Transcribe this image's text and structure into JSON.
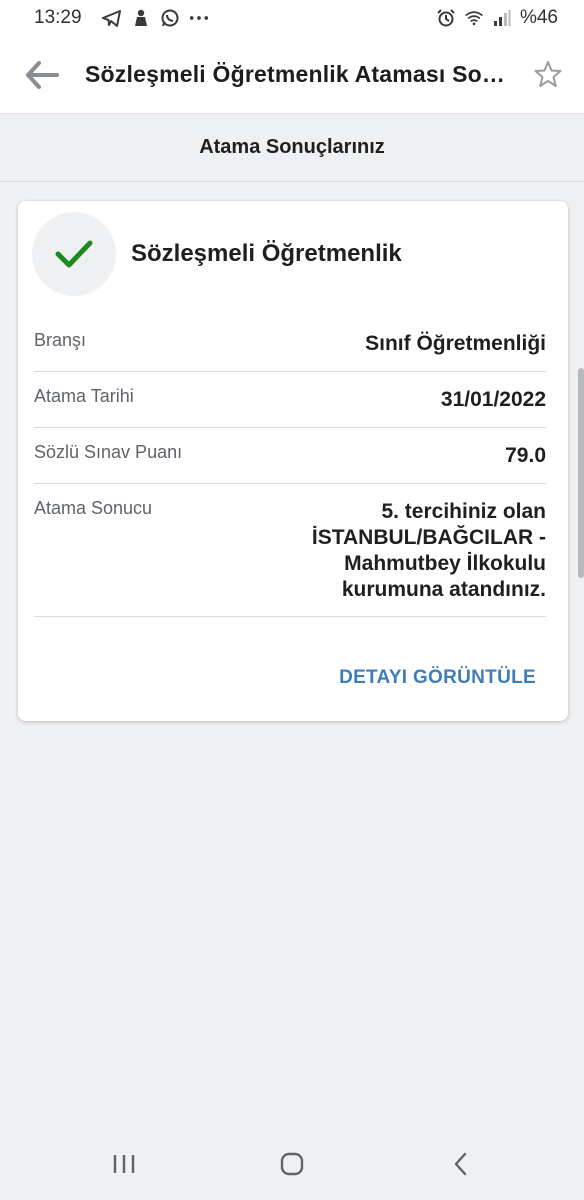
{
  "status_bar": {
    "time": "13:29",
    "battery": "%46",
    "icons": [
      "telegram-icon",
      "notification-icon",
      "whatsapp-icon",
      "more-dots-icon",
      "alarm-icon",
      "wifi-icon",
      "signal-icon"
    ]
  },
  "app_bar": {
    "title": "Sözleşmeli Öğretmenlik Ataması Sonuçları",
    "back_icon": "back-arrow-icon",
    "favorite_icon": "star-outline-icon"
  },
  "section": {
    "title": "Atama Sonuçlarınız"
  },
  "card": {
    "title": "Sözleşmeli Öğretmenlik",
    "status_icon": "checkmark-icon",
    "status_color": "#1e8a1e",
    "rows": [
      {
        "label": "Branşı",
        "value": "Sınıf Öğretmenliği"
      },
      {
        "label": "Atama Tarihi",
        "value": "31/01/2022"
      },
      {
        "label": "Sözlü Sınav Puanı",
        "value": "79.0"
      },
      {
        "label": "Atama Sonucu",
        "value": "5. tercihiniz olan\nİSTANBUL/BAĞCILAR -\nMahmutbey İlkokulu\nkurumuna atandınız."
      }
    ],
    "action_label": "DETAYI GÖRÜNTÜLE",
    "action_color": "#3f7db8"
  },
  "nav_bar": {
    "icons": [
      "recent-apps-icon",
      "home-icon",
      "back-icon"
    ]
  }
}
